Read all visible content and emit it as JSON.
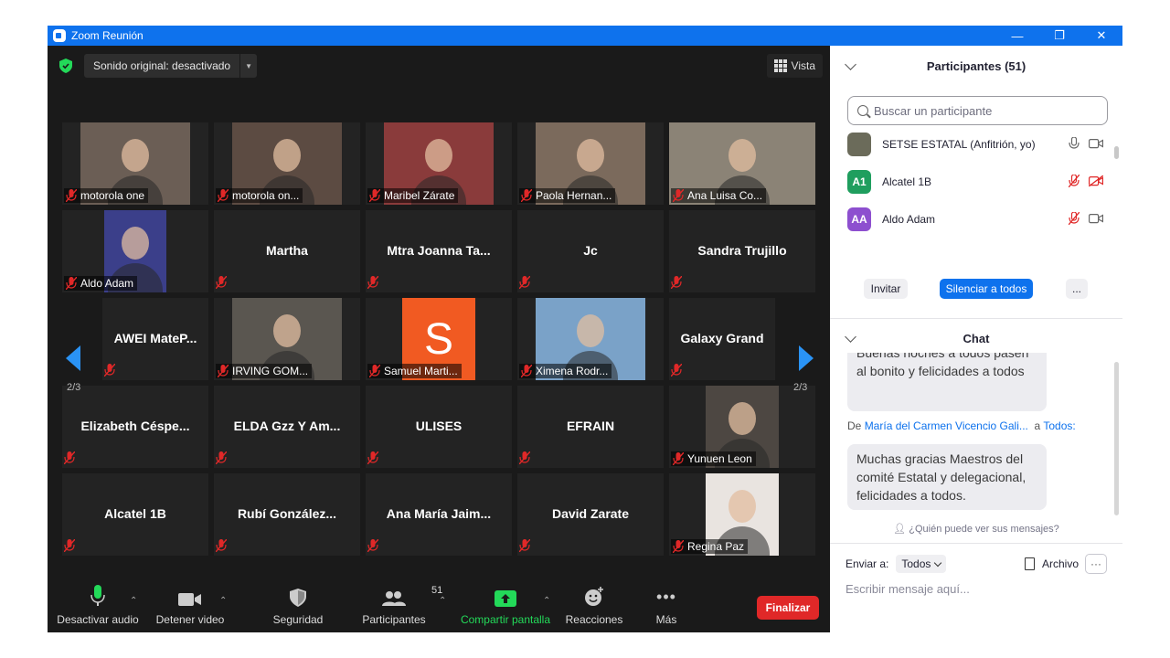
{
  "window": {
    "title": "Zoom Reunión"
  },
  "topbar": {
    "sound_label": "Sonido original: desactivado",
    "view_label": "Vista"
  },
  "gallery": {
    "page_left": "2/3",
    "page_right": "2/3",
    "tiles": [
      {
        "name": "motorola one",
        "video": true
      },
      {
        "name": "motorola on...",
        "video": true
      },
      {
        "name": "Maribel Zárate",
        "video": true
      },
      {
        "name": "Paola Hernan...",
        "video": true
      },
      {
        "name": "Ana Luisa Co...",
        "video": true
      },
      {
        "name": "Aldo Adam",
        "video": true
      },
      {
        "name": "Martha",
        "video": false
      },
      {
        "name": "Mtra Joanna Ta...",
        "video": false
      },
      {
        "name": "Jc",
        "video": false
      },
      {
        "name": "Sandra Trujillo",
        "video": false
      },
      {
        "name": "AWEI MateP...",
        "video": false
      },
      {
        "name": "IRVING GOM...",
        "video": true
      },
      {
        "name": "Samuel Marti...",
        "video": true,
        "avatar_letter": "S"
      },
      {
        "name": "Ximena Rodr...",
        "video": true
      },
      {
        "name": "Galaxy Grand",
        "video": false
      },
      {
        "name": "Elizabeth Céspe...",
        "video": false
      },
      {
        "name": "ELDA Gzz Y Am...",
        "video": false
      },
      {
        "name": "ULISES",
        "video": false
      },
      {
        "name": "EFRAIN",
        "video": false
      },
      {
        "name": "Yunuen Leon",
        "video": true
      },
      {
        "name": "Alcatel 1B",
        "video": false
      },
      {
        "name": "Rubí González...",
        "video": false
      },
      {
        "name": "Ana María Jaim...",
        "video": false
      },
      {
        "name": "David Zarate",
        "video": false
      },
      {
        "name": "Regina Paz",
        "video": true
      }
    ]
  },
  "toolbar": {
    "mute": "Desactivar audio",
    "video": "Detener video",
    "security": "Seguridad",
    "participants": "Participantes",
    "participants_count": "51",
    "share": "Compartir pantalla",
    "reactions": "Reacciones",
    "more": "Más",
    "end": "Finalizar"
  },
  "participants_panel": {
    "title": "Participantes (51)",
    "search_placeholder": "Buscar un participante",
    "list": [
      {
        "name": "SETSE ESTATAL (Anfitrión, yo)",
        "avatar": "",
        "avatar_color": "#6b6b5a",
        "muted": false,
        "video_off": false
      },
      {
        "name": "Alcatel 1B",
        "avatar": "A1",
        "avatar_color": "#1f9e5e",
        "muted": true,
        "video_off": true
      },
      {
        "name": "Aldo Adam",
        "avatar": "AA",
        "avatar_color": "#8d4fcf",
        "muted": true,
        "video_off": false
      }
    ],
    "invite": "Invitar",
    "mute_all": "Silenciar a todos",
    "more": "..."
  },
  "chat": {
    "title": "Chat",
    "msg1": "Buenas noches a todos pasen al bonito y felicidades a todos",
    "from_prefix": "De",
    "from_name": "María del Carmen Vicencio Gali...",
    "to_prefix": "a",
    "to_name": "Todos:",
    "msg2": "Muchas gracias Maestros del comité Estatal y delegacional, felicidades a todos.",
    "who_can_see": "¿Quién puede ver sus mensajes?",
    "send_to": "Enviar a:",
    "send_to_value": "Todos",
    "file": "Archivo",
    "more": "···",
    "input_placeholder": "Escribir mensaje aquí..."
  },
  "colors": {
    "accent": "#0e72ed",
    "end_red": "#e02828",
    "share_green": "#23d959",
    "muted_red": "#e02828"
  }
}
